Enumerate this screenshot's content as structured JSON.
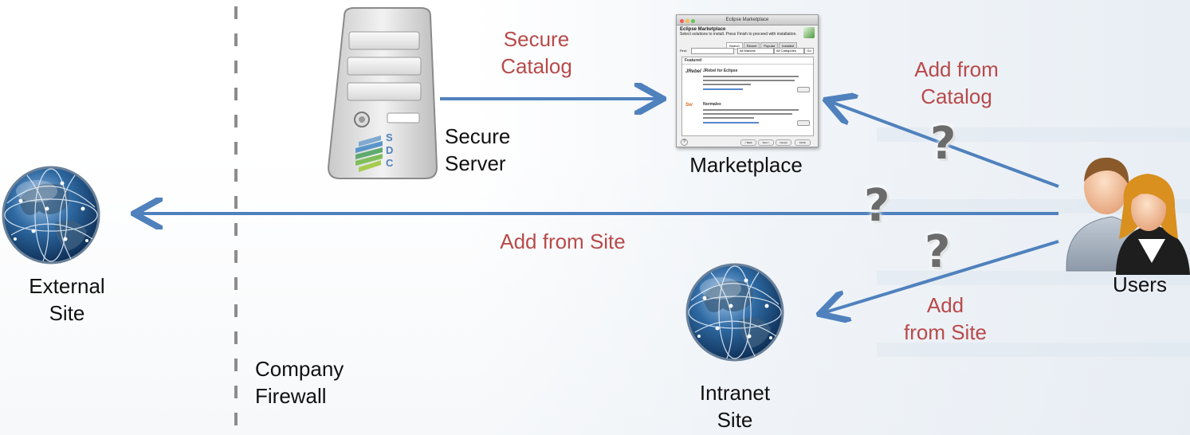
{
  "labels": {
    "secure_catalog_line1": "Secure",
    "secure_catalog_line2": "Catalog",
    "secure_server_line1": "Secure",
    "secure_server_line2": "Server",
    "marketplace": "Marketplace",
    "add_from_catalog_line1": "Add from",
    "add_from_catalog_line2": "Catalog",
    "add_from_site": "Add from Site",
    "external_site_line1": "External",
    "external_site_line2": "Site",
    "users": "Users",
    "add_line1": "Add",
    "add_line2": "from Site",
    "intranet_site_line1": "Intranet",
    "intranet_site_line2": "Site",
    "company_firewall_line1": "Company",
    "company_firewall_line2": "Firewall"
  },
  "server_logo_letters": [
    "S",
    "D",
    "C"
  ],
  "question_mark": "?",
  "marketplace_window": {
    "title": "Eclipse Marketplace",
    "heading": "Eclipse Marketplace",
    "description": "Select solutions to install. Press Finish to proceed with installation.",
    "tabs": [
      "Search",
      "Recent",
      "Popular",
      "Installed"
    ],
    "find_label": "Find:",
    "market_select": "All Markets",
    "category_select": "All Categories",
    "go_label": "Go",
    "featured_label": "Featured",
    "entries": [
      {
        "name": "JRebel for Eclipse",
        "logo": "JRebel"
      },
      {
        "name": "Normalex",
        "logo": "Sw"
      }
    ],
    "footer_buttons": [
      "< Back",
      "Next >",
      "Cancel",
      "Finish"
    ]
  },
  "colors": {
    "arrow": "#4f81bd",
    "accent_text": "#b84a4a",
    "dark_text": "#111111",
    "firewall_dash": "#8c8c8c"
  },
  "icons": [
    "server-icon",
    "globe-icon",
    "users-icon",
    "marketplace-window-icon"
  ]
}
